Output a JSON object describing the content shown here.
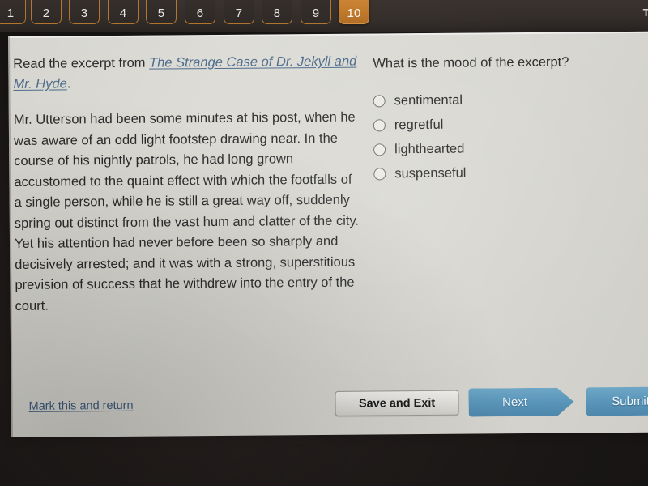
{
  "top_bar": {
    "tabs": [
      {
        "label": "1",
        "active": false
      },
      {
        "label": "2",
        "active": false
      },
      {
        "label": "3",
        "active": false
      },
      {
        "label": "4",
        "active": false
      },
      {
        "label": "5",
        "active": false
      },
      {
        "label": "6",
        "active": false
      },
      {
        "label": "7",
        "active": false
      },
      {
        "label": "8",
        "active": false
      },
      {
        "label": "9",
        "active": false
      },
      {
        "label": "10",
        "active": true
      }
    ],
    "timer_label": "TI",
    "active_tab_color": "#c37a2b",
    "tab_border_color": "#b4762f"
  },
  "excerpt": {
    "prompt_lead": "Read the excerpt from ",
    "book_title": "The Strange Case of Dr. Jekyll and Mr. Hyde",
    "prompt_end": ".",
    "body": "Mr. Utterson had been some minutes at his post, when he was aware of an odd light footstep drawing near. In the course of his nightly patrols, he had long grown accustomed to the quaint effect with which the footfalls of a single person, while he is still a great way off, suddenly spring out distinct from the vast hum and clatter of the city. Yet his attention had never before been so sharply and decisively arrested; and it was with a strong, superstitious prevision of success that he withdrew into the entry of the court.",
    "link_color": "#4d6c8c"
  },
  "question": {
    "text": "What is the mood of the excerpt?",
    "options": [
      {
        "label": "sentimental",
        "selected": false
      },
      {
        "label": "regretful",
        "selected": false
      },
      {
        "label": "lighthearted",
        "selected": false
      },
      {
        "label": "suspenseful",
        "selected": false
      }
    ]
  },
  "actions": {
    "mark_and_return": "Mark this and return",
    "save_and_exit": "Save and Exit",
    "next": "Next",
    "submit": "Submit",
    "primary_button_color": "#5a96ba"
  }
}
